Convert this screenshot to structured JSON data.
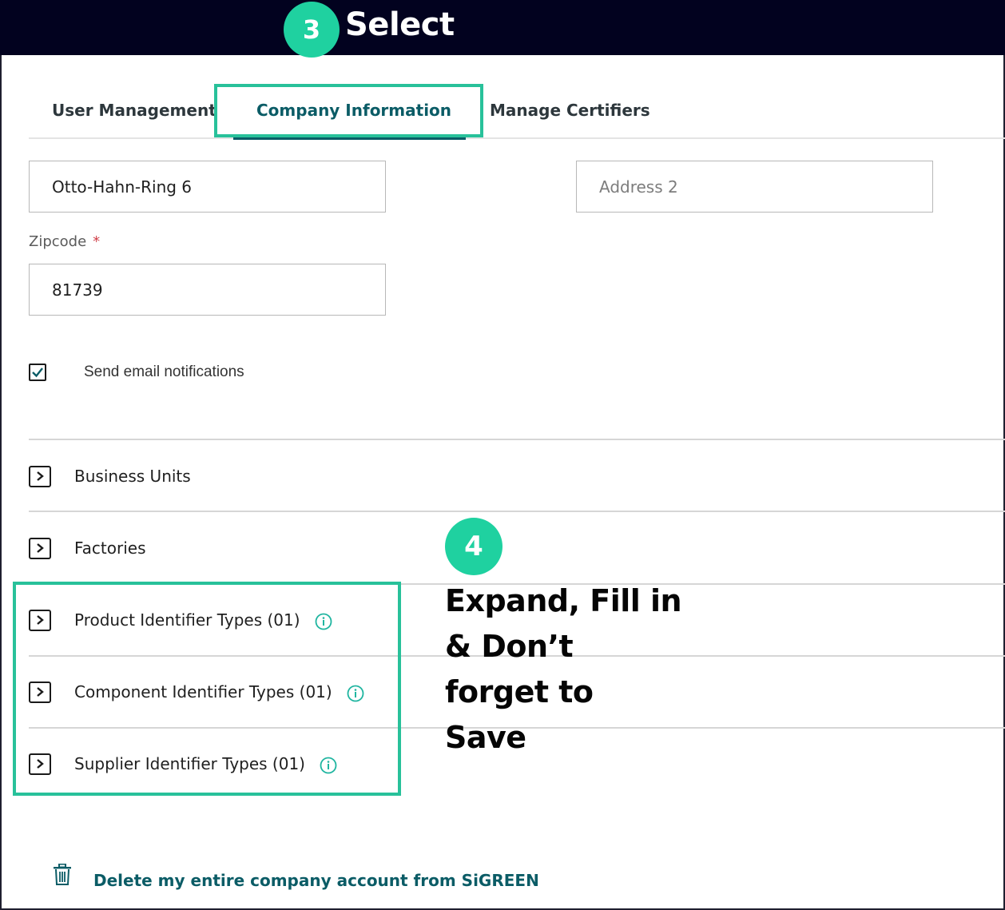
{
  "banner": {
    "step_number": "3",
    "label": "Select"
  },
  "tabs": [
    {
      "label": "User Management",
      "active": false
    },
    {
      "label": "Company Information",
      "active": true
    },
    {
      "label": "Manage Certifiers",
      "active": false
    }
  ],
  "form": {
    "address1_value": "Otto-Hahn-Ring 6",
    "address2_placeholder": "Address 2",
    "zipcode_label": "Zipcode",
    "zipcode_required_marker": "*",
    "zipcode_value": "81739",
    "email_notifications_label": "Send email notifications",
    "email_notifications_checked": true
  },
  "accordion": [
    {
      "label": "Business Units",
      "info": false
    },
    {
      "label": "Factories",
      "info": false
    },
    {
      "label": "Product Identifier Types (01)",
      "info": true
    },
    {
      "label": "Component Identifier Types (01)",
      "info": true
    },
    {
      "label": "Supplier Identifier Types (01)",
      "info": true
    }
  ],
  "callout": {
    "step_number": "4",
    "text": "Expand, Fill in\n& Don’t\nforget to\nSave"
  },
  "footer": {
    "delete_label": "Delete my entire company account from SiGREEN"
  },
  "colors": {
    "banner_bg": "#02021f",
    "highlight": "#28c19a",
    "badge": "#1fd1a0",
    "brand_teal": "#0b5c66",
    "required": "#d0404a"
  }
}
